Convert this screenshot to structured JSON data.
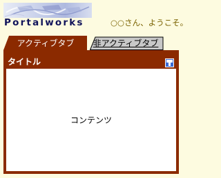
{
  "header": {
    "logo_text": "Portalworks",
    "welcome": "○○さん、ようこそ。"
  },
  "tabs": [
    {
      "label": "アクティブタブ",
      "active": true
    },
    {
      "label": "非アクティブタブ",
      "active": false
    }
  ],
  "portlet": {
    "title": "タイトル",
    "help_icon": "help-icon",
    "content": "コンテンツ"
  },
  "colors": {
    "accent": "#8b2a00",
    "page_background": "#fdfbe0",
    "inactive_tab": "#c8c8c8",
    "logo_text": "#10135a",
    "welcome_text": "#7a6200"
  }
}
